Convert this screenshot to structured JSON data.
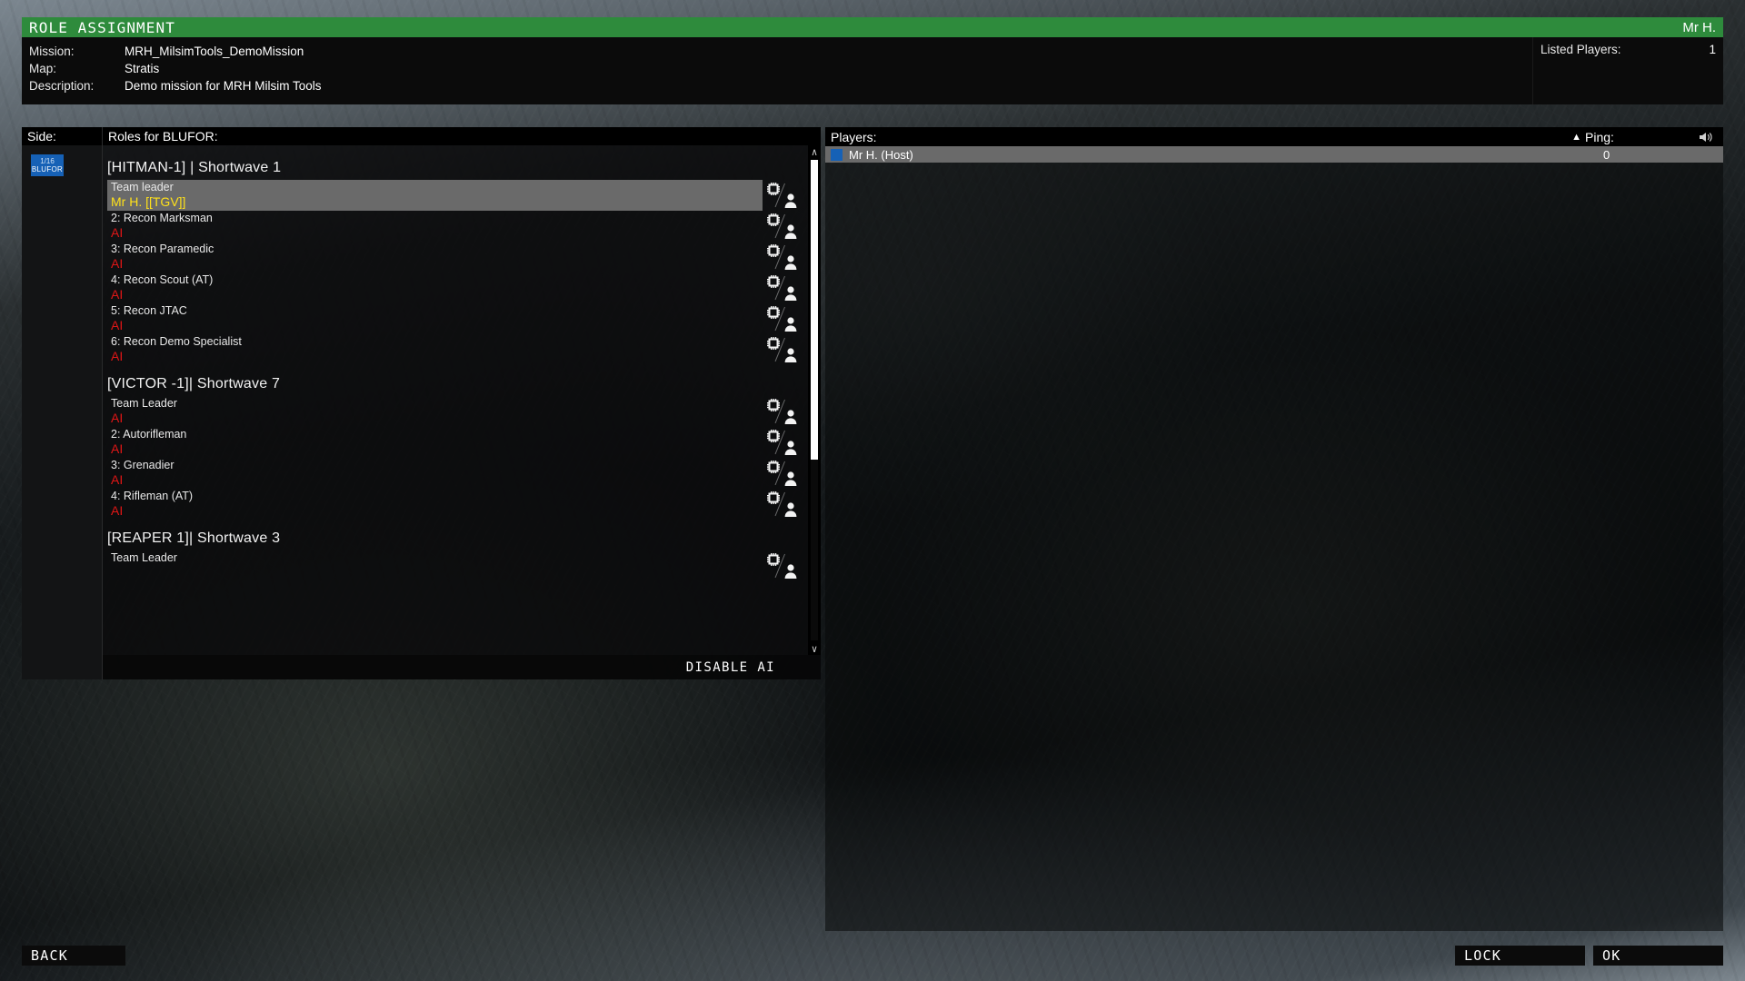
{
  "window": {
    "title": "ROLE ASSIGNMENT",
    "user": "Mr H.",
    "accent_color": "#2e8b3c"
  },
  "mission_info": {
    "mission_label": "Mission:",
    "mission_value": "MRH_MilsimTools_DemoMission",
    "map_label": "Map:",
    "map_value": "Stratis",
    "description_label": "Description:",
    "description_value": "Demo mission for MRH Milsim Tools",
    "listed_players_label": "Listed Players:",
    "listed_players_value": "1"
  },
  "side": {
    "header": "Side:",
    "badge": {
      "count": "1/16",
      "name": "BLUFOR",
      "color": "#1661b6"
    }
  },
  "roles": {
    "header": "Roles for BLUFOR:",
    "disable_ai_label": "DISABLE AI",
    "scroll_up": "∧",
    "scroll_down": "∨",
    "groups": [
      {
        "title": "[HITMAN-1] | Shortwave 1",
        "slots": [
          {
            "name": "Team leader",
            "occupant": "Mr H. [[TGV]]",
            "type": "player",
            "selected": true
          },
          {
            "name": "2: Recon Marksman",
            "occupant": "AI",
            "type": "ai",
            "selected": false
          },
          {
            "name": "3: Recon Paramedic",
            "occupant": "AI",
            "type": "ai",
            "selected": false
          },
          {
            "name": "4: Recon Scout (AT)",
            "occupant": "AI",
            "type": "ai",
            "selected": false
          },
          {
            "name": "5: Recon JTAC",
            "occupant": "AI",
            "type": "ai",
            "selected": false
          },
          {
            "name": "6: Recon Demo Specialist",
            "occupant": "AI",
            "type": "ai",
            "selected": false
          }
        ]
      },
      {
        "title": "[VICTOR -1]| Shortwave 7",
        "slots": [
          {
            "name": "Team Leader",
            "occupant": "AI",
            "type": "ai",
            "selected": false
          },
          {
            "name": "2: Autorifleman",
            "occupant": "AI",
            "type": "ai",
            "selected": false
          },
          {
            "name": "3: Grenadier",
            "occupant": "AI",
            "type": "ai",
            "selected": false
          },
          {
            "name": "4: Rifleman (AT)",
            "occupant": "AI",
            "type": "ai",
            "selected": false
          }
        ]
      },
      {
        "title": "[REAPER 1]| Shortwave 3",
        "slots": [
          {
            "name": "Team Leader",
            "occupant": "",
            "type": "ai",
            "selected": false
          }
        ]
      }
    ]
  },
  "players": {
    "header": "Players:",
    "sort_arrow": "▲",
    "ping_header": "Ping:",
    "rows": [
      {
        "name": "Mr H. (Host)",
        "ping": "0",
        "color": "#1661b6"
      }
    ]
  },
  "buttons": {
    "back": "BACK",
    "lock": "LOCK",
    "ok": "OK"
  }
}
